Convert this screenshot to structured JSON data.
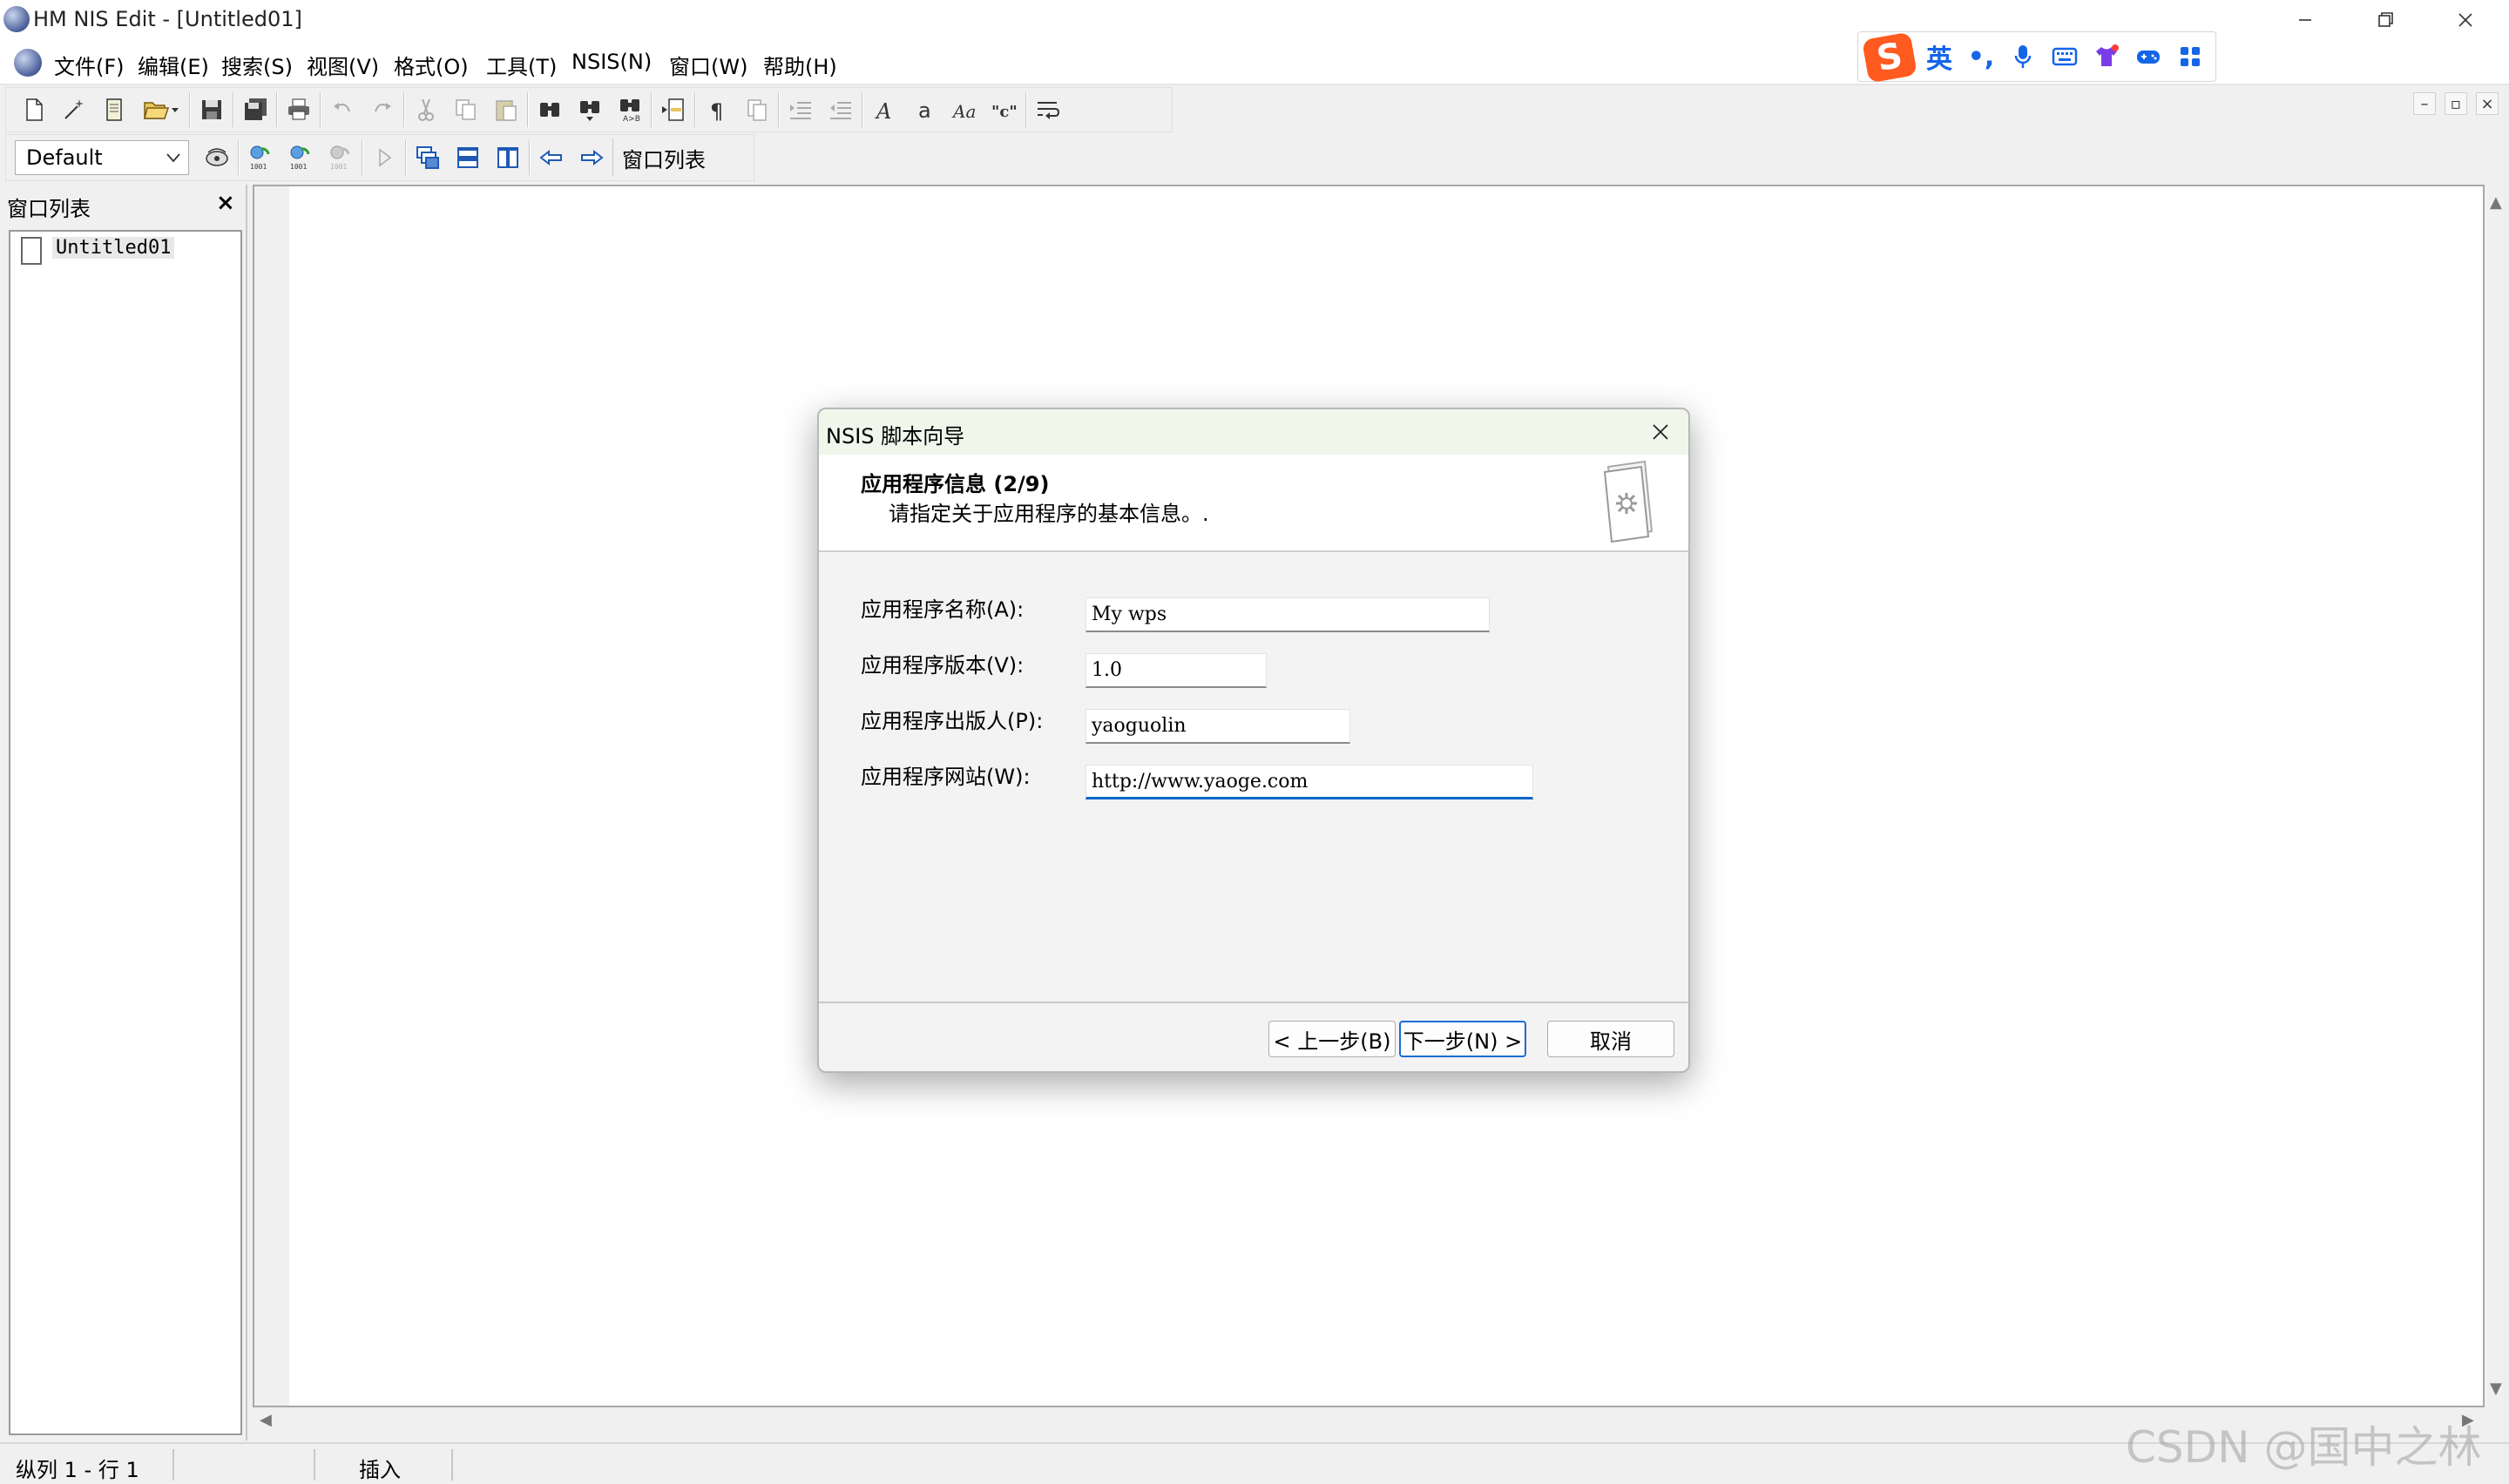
{
  "window": {
    "title": "HM NIS Edit - [Untitled01]"
  },
  "menu": [
    "文件(F)",
    "编辑(E)",
    "搜索(S)",
    "视图(V)",
    "格式(O)",
    "工具(T)",
    "NSIS(N)",
    "窗口(W)",
    "帮助(H)"
  ],
  "ime": {
    "logo": "S",
    "lang": "英",
    "punct": "•,"
  },
  "toolbar": {
    "style_combo": "Default",
    "window_list_button": "窗口列表"
  },
  "window_list": {
    "title": "窗口列表",
    "close": "×",
    "items": [
      "Untitled01"
    ]
  },
  "statusbar": {
    "position": "纵列 1 - 行 1",
    "mode": "插入"
  },
  "watermark": "CSDN @国中之林",
  "dialog": {
    "title": "NSIS 脚本向导",
    "heading": "应用程序信息 (2/9)",
    "subheading": "请指定关于应用程序的基本信息。.",
    "fields": [
      {
        "label": "应用程序名称(A):",
        "value": "My wps"
      },
      {
        "label": "应用程序版本(V):",
        "value": "1.0"
      },
      {
        "label": "应用程序出版人(P):",
        "value": "yaoguolin"
      },
      {
        "label": "应用程序网站(W):",
        "value": "http://www.yaoge.com"
      }
    ],
    "buttons": {
      "back": "< 上一步(B)",
      "next": "下一步(N) >",
      "cancel": "取消"
    }
  }
}
